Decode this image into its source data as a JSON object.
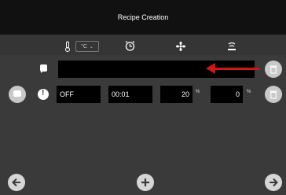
{
  "header": {
    "title": "Recipe Creation"
  },
  "toolbar": {
    "unit": "°C",
    "icons": [
      "thermometer-icon",
      "alarm-clock-icon",
      "fan-icon",
      "steam-icon"
    ]
  },
  "row2": {
    "state": "OFF",
    "time": "00:01",
    "percent1": "20",
    "percent1_unit": "%",
    "percent2": "0",
    "percent2_unit": "%"
  }
}
